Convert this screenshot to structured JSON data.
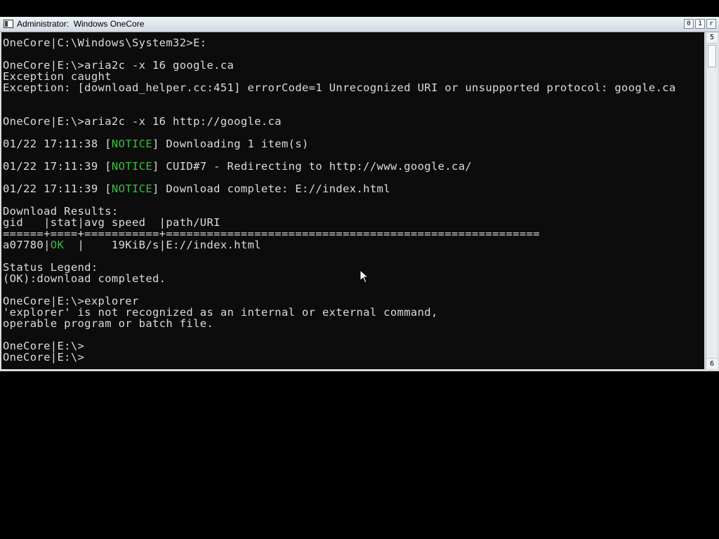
{
  "window": {
    "title": "Administrator:  Windows OneCore",
    "controls": {
      "minimize": "0",
      "maximize": "1",
      "close": "r"
    },
    "scroll_up_glyph": "5",
    "scroll_down_glyph": "6"
  },
  "console": {
    "lines": [
      "OneCore|C:\\Windows\\System32>E:",
      "OneCore|E:\\>aria2c -x 16 google.ca",
      "Exception caught",
      "Exception: [download_helper.cc:451] errorCode=1 Unrecognized URI or unsupported protocol: google.ca",
      "OneCore|E:\\>aria2c -x 16 http://google.ca",
      "01/22 17:11:38 [",
      "NOTICE",
      "] Downloading 1 item(s)",
      "01/22 17:11:39 [",
      "NOTICE",
      "] CUID#7 - Redirecting to http://www.google.ca/",
      "01/22 17:11:39 [",
      "NOTICE",
      "] Download complete: E://index.html",
      "Download Results:",
      "gid   |stat|avg speed  |path/URI",
      "======+====+===========+=======================================================",
      "a07780|",
      "OK",
      "  |    19KiB/s|E://index.html",
      "Status Legend:",
      "(OK):download completed.",
      "OneCore|E:\\>explorer",
      "'explorer' is not recognized as an internal or external command,",
      "operable program or batch file.",
      "OneCore|E:\\>",
      "OneCore|E:\\>"
    ]
  },
  "colors": {
    "console_bg": "#0c0c0c",
    "console_text": "#dcdcdc",
    "notice_green": "#3cbd3c",
    "desktop_bg": "#000000"
  }
}
